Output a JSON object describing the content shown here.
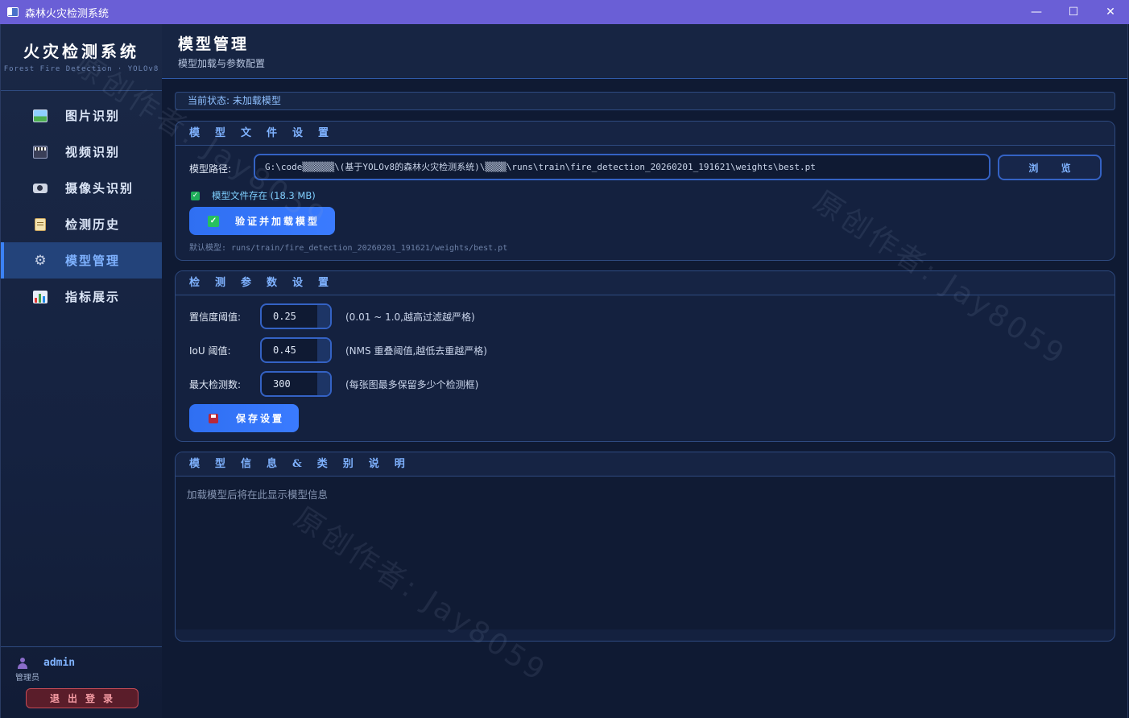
{
  "window": {
    "title": "森林火灾检测系统",
    "controls": {
      "minimize": "—",
      "maximize": "☐",
      "close": "✕"
    }
  },
  "sidebar": {
    "brand_title": "火灾检测系统",
    "brand_sub": "Forest Fire Detection · YOLOv8",
    "items": [
      {
        "label": "图片识别",
        "icon": "picture-icon",
        "active": false
      },
      {
        "label": "视频识别",
        "icon": "video-clapper-icon",
        "active": false
      },
      {
        "label": "摄像头识别",
        "icon": "camera-icon",
        "active": false
      },
      {
        "label": "检测历史",
        "icon": "history-icon",
        "active": false
      },
      {
        "label": "模型管理",
        "icon": "gear-icon",
        "active": true
      },
      {
        "label": "指标展示",
        "icon": "bar-chart-icon",
        "active": false
      }
    ],
    "user": {
      "name": "admin",
      "role": "管理员"
    },
    "logout_label": "退出登录"
  },
  "header": {
    "title": "模型管理",
    "subtitle": "模型加载与参数配置"
  },
  "status": "当前状态: 未加载模型",
  "model_file": {
    "section_title": "模型文件设置",
    "path_label": "模型路径:",
    "path_value": "G:\\code▒▒▒▒▒▒\\(基于YOLOv8的森林火灾检测系统)\\▒▒▒▒\\runs\\train\\fire_detection_20260201_191621\\weights\\best.pt",
    "browse_label": "浏 览",
    "exists_text": "模型文件存在 (18.3 MB)",
    "load_button": "验证并加载模型",
    "default_model": "默认模型: runs/train/fire_detection_20260201_191621/weights/best.pt"
  },
  "detect_params": {
    "section_title": "检测参数设置",
    "confidence_label": "置信度阈值:",
    "confidence_value": "0.25",
    "confidence_hint": "(0.01 ~ 1.0,越高过滤越严格)",
    "iou_label": "IoU 阈值:",
    "iou_value": "0.45",
    "iou_hint": "(NMS 重叠阈值,越低去重越严格)",
    "max_det_label": "最大检测数:",
    "max_det_value": "300",
    "max_det_hint": "(每张图最多保留多少个检测框)",
    "save_button": "保存设置"
  },
  "model_info": {
    "section_title": "模型信息&类别说明",
    "placeholder": "加载模型后将在此显示模型信息"
  },
  "watermark": "原创作者: Jay8059",
  "colors": {
    "accent": "#3b82f6",
    "titlebar": "#6a5fd6",
    "background": "#0f1a33",
    "success": "#1fae5a",
    "danger": "#c44a55"
  }
}
